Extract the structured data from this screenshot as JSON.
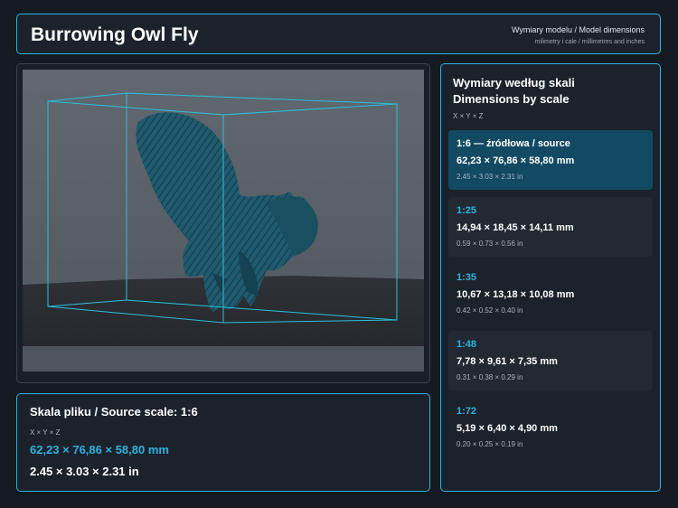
{
  "header": {
    "title": "Burrowing Owl Fly",
    "subtitle": "Wymiary modelu / Model dimensions",
    "units_note": "milimetry i cale / millimetres and inches"
  },
  "source": {
    "title": "Skala pliku / Source scale: 1:6",
    "axes": "X × Y × Z",
    "mm": "62,23 × 76,86 × 58,80 mm",
    "inches": "2.45 × 3.03 × 2.31 in"
  },
  "scales": {
    "title_pl": "Wymiary według skali",
    "title_en": "Dimensions by scale",
    "axes": "X × Y × Z",
    "items": [
      {
        "scale": "1:6  —  źródłowa / source",
        "mm": "62,23 × 76,86 × 58,80 mm",
        "inches": "2.45 × 3.03 × 2.31 in"
      },
      {
        "scale": "1:25",
        "mm": "14,94 × 18,45 × 14,11 mm",
        "inches": "0.59 × 0.73 × 0.56 in"
      },
      {
        "scale": "1:35",
        "mm": "10,67 × 13,18 × 10,08 mm",
        "inches": "0.42 × 0.52 × 0.40 in"
      },
      {
        "scale": "1:48",
        "mm": "7,78 × 9,61 × 7,35 mm",
        "inches": "0.31 × 0.38 × 0.29 in"
      },
      {
        "scale": "1:72",
        "mm": "5,19 × 6,40 × 4,90 mm",
        "inches": "0.20 × 0.25 × 0.19 in"
      }
    ]
  },
  "colors": {
    "accent": "#2bb3e0",
    "active_card": "#134a63",
    "model": "#1f5a6e"
  }
}
